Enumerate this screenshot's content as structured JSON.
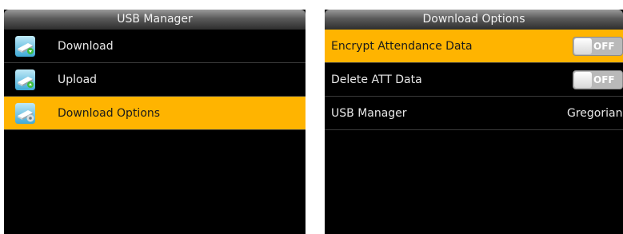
{
  "left_screen": {
    "title": "USB Manager",
    "items": [
      {
        "label": "Download",
        "icon": "download-icon",
        "selected": false
      },
      {
        "label": "Upload",
        "icon": "upload-icon",
        "selected": false
      },
      {
        "label": "Download Options",
        "icon": "download-options-icon",
        "selected": true
      }
    ]
  },
  "right_screen": {
    "title": "Download Options",
    "items": [
      {
        "label": "Encrypt Attendance Data",
        "toggle": "OFF",
        "selected": true
      },
      {
        "label": "Delete ATT Data",
        "toggle": "OFF",
        "selected": false
      },
      {
        "label": "USB Manager",
        "value": "Gregorian",
        "selected": false
      }
    ]
  },
  "colors": {
    "highlight": "#ffb400",
    "background": "#000000",
    "text": "#e8e8e8"
  }
}
